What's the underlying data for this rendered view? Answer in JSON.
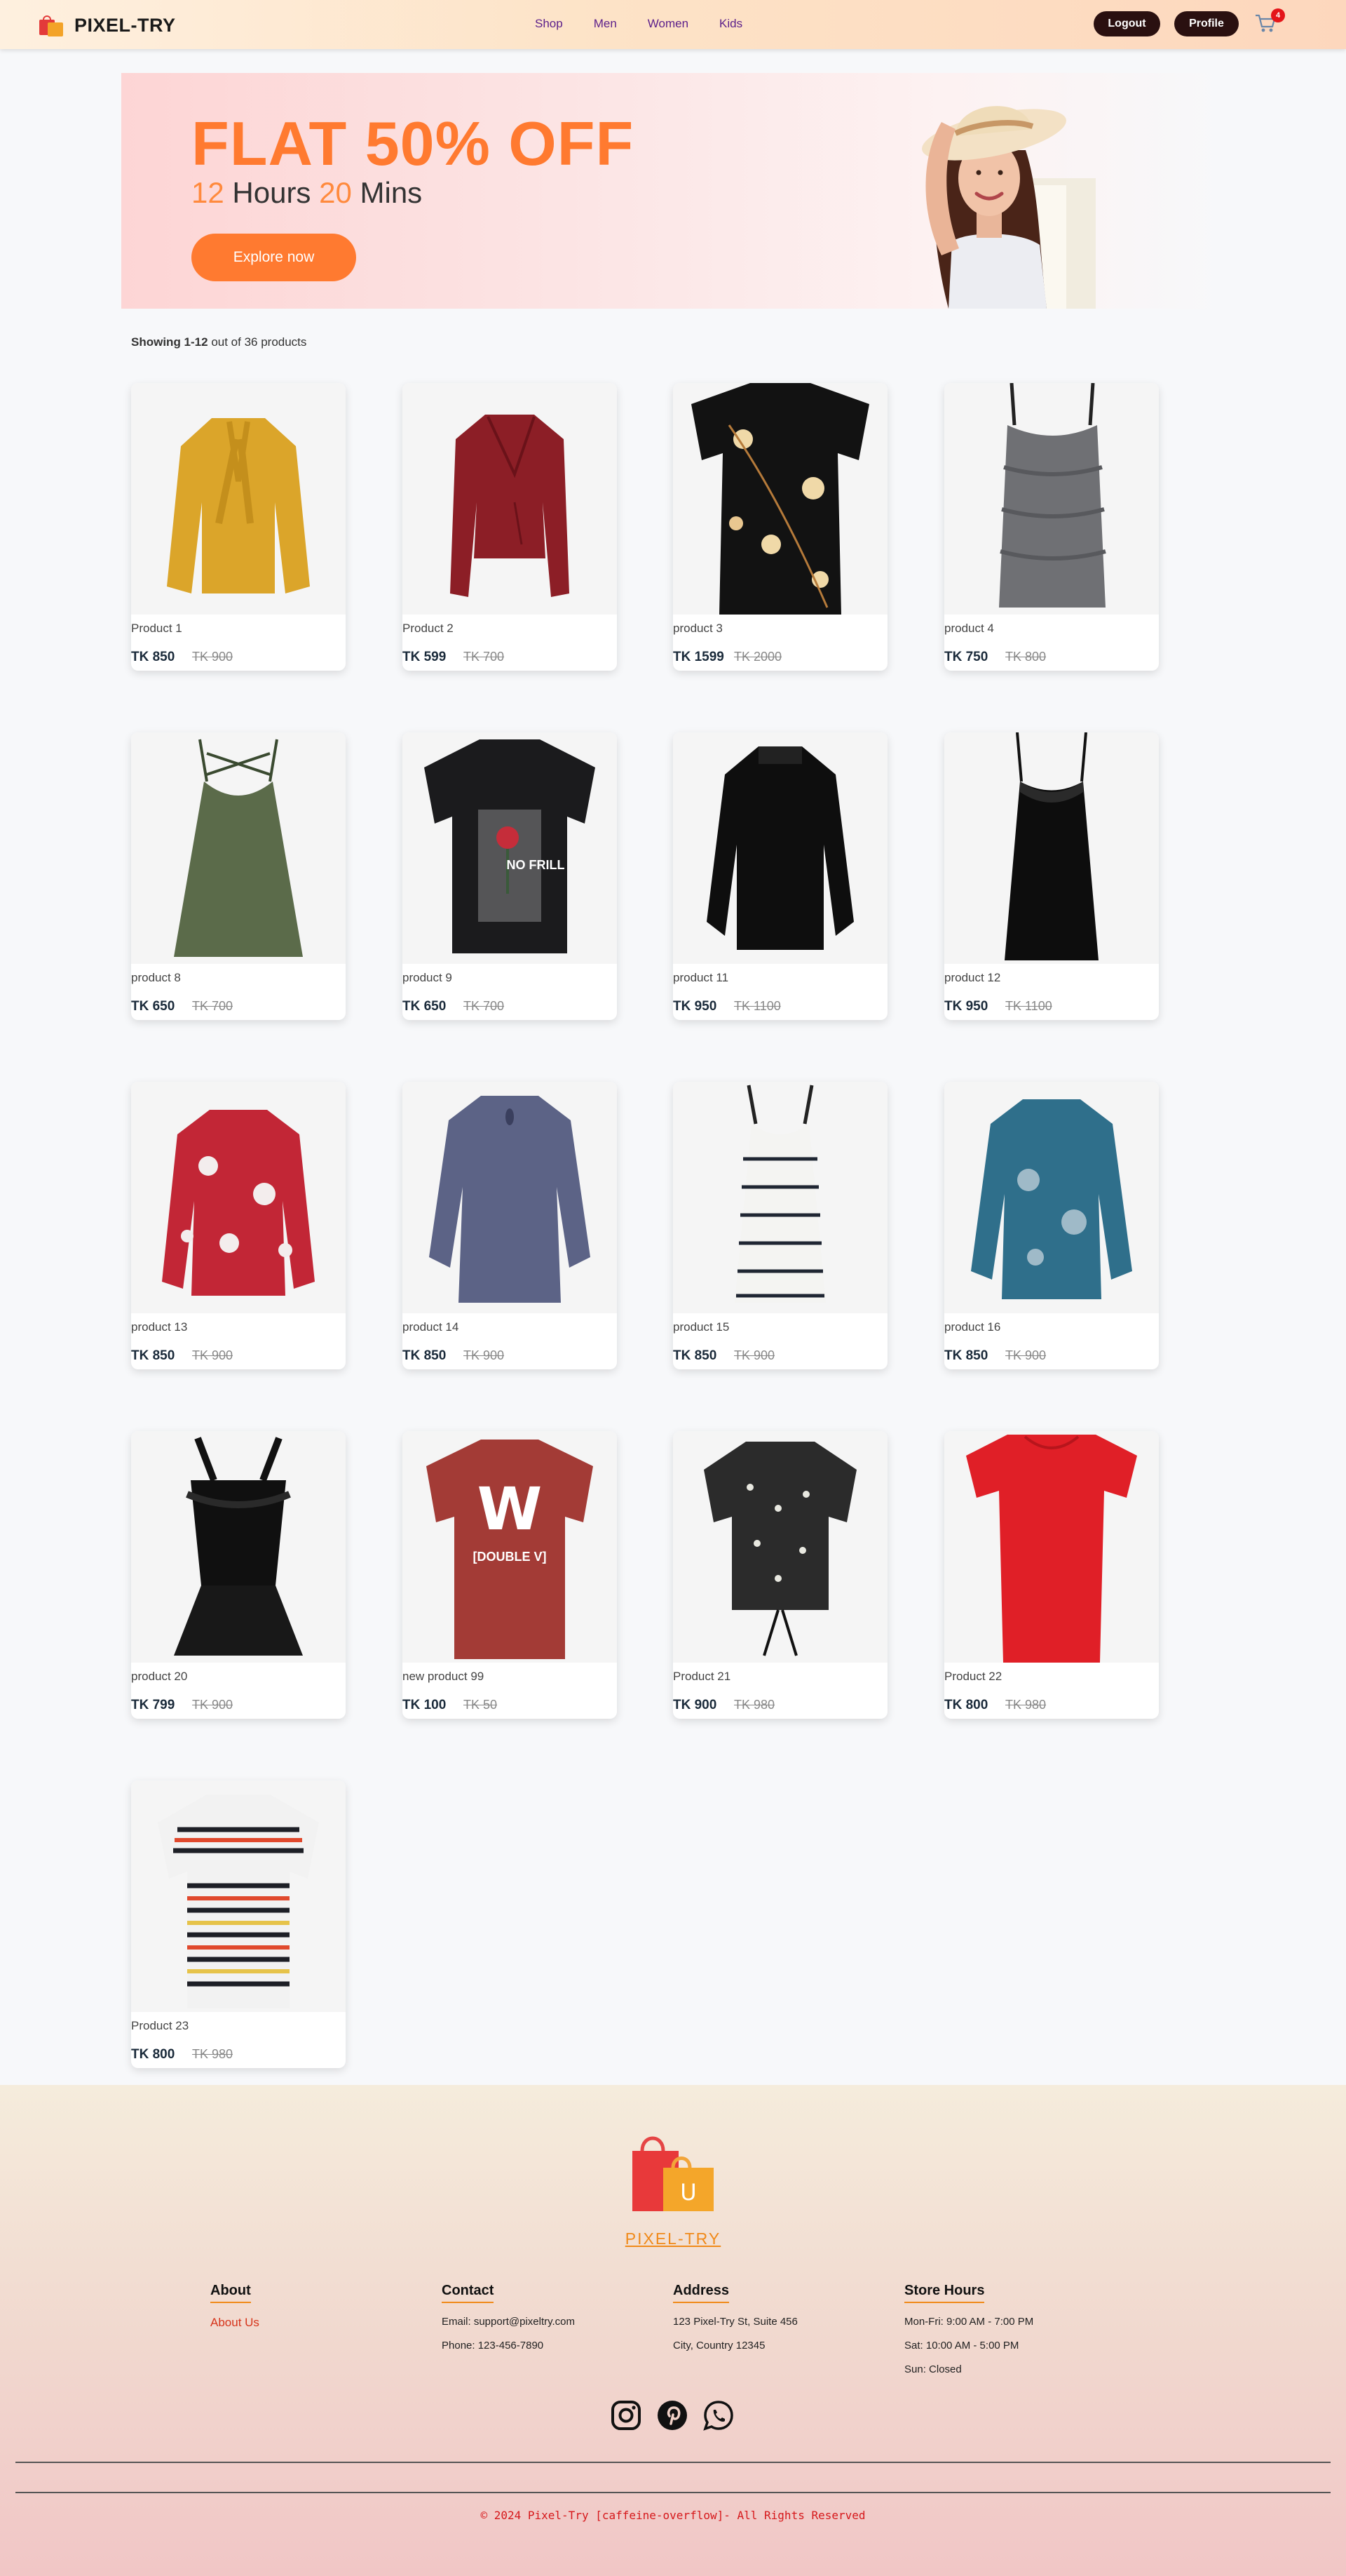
{
  "navbar": {
    "brand": "PIXEL-TRY",
    "links": [
      "Shop",
      "Men",
      "Women",
      "Kids"
    ],
    "logout_label": "Logout",
    "profile_label": "Profile",
    "cart_count": "4"
  },
  "hero": {
    "title": "FLAT 50% OFF",
    "timer_hours": "12",
    "timer_hours_label": "Hours",
    "timer_mins": "20",
    "timer_mins_label": "Mins",
    "button_label": "Explore now"
  },
  "listing": {
    "showing_bold": "Showing 1-12",
    "showing_rest": "out of 36 products"
  },
  "products": [
    {
      "name": "Product 1",
      "price": "TK 850",
      "old_price": "TK 900",
      "image": "mustard-bow-blouse"
    },
    {
      "name": "Product 2",
      "price": "TK 599",
      "old_price": "TK 700",
      "image": "burgundy-wrap-blouse"
    },
    {
      "name": "product 3",
      "price": "TK 1599",
      "old_price": "TK 2000",
      "image": "black-floral-top"
    },
    {
      "name": "product 4",
      "price": "TK 750",
      "old_price": "TK 800",
      "image": "grey-ruched-camisole"
    },
    {
      "name": "product 8",
      "price": "TK 650",
      "old_price": "TK 700",
      "image": "olive-cami-top"
    },
    {
      "name": "product 9",
      "price": "TK 650",
      "old_price": "TK 700",
      "image": "black-graphic-tshirt"
    },
    {
      "name": "product 11",
      "price": "TK 950",
      "old_price": "TK 1100",
      "image": "black-sheer-blouse"
    },
    {
      "name": "product 12",
      "price": "TK 950",
      "old_price": "TK 1100",
      "image": "black-slip-dress"
    },
    {
      "name": "product 13",
      "price": "TK 850",
      "old_price": "TK 900",
      "image": "red-floral-blouse"
    },
    {
      "name": "product 14",
      "price": "TK 850",
      "old_price": "TK 900",
      "image": "navy-keyhole-blouse"
    },
    {
      "name": "product 15",
      "price": "TK 850",
      "old_price": "TK 900",
      "image": "striped-tank-top"
    },
    {
      "name": "product 16",
      "price": "TK 850",
      "old_price": "TK 900",
      "image": "teal-paisley-top"
    },
    {
      "name": "product 20",
      "price": "TK 799",
      "old_price": "TK 900",
      "image": "black-ruffle-top"
    },
    {
      "name": "new product 99",
      "price": "TK 100",
      "old_price": "TK 50",
      "image": "red-logo-tshirt"
    },
    {
      "name": "Product 21",
      "price": "TK 900",
      "old_price": "TK 980",
      "image": "polka-dot-sheer-top"
    },
    {
      "name": "Product 22",
      "price": "TK 800",
      "old_price": "TK 980",
      "image": "red-bodycon-dress"
    },
    {
      "name": "Product 23",
      "price": "TK 800",
      "old_price": "TK 980",
      "image": "multicolor-striped-tee"
    }
  ],
  "footer": {
    "brand": "PIXEL-TRY",
    "about": {
      "title": "About",
      "link": "About Us"
    },
    "contact": {
      "title": "Contact",
      "email": "Email: support@pixeltry.com",
      "phone": "Phone: 123-456-7890"
    },
    "address": {
      "title": "Address",
      "line1": "123 Pixel-Try St, Suite 456",
      "line2": "City, Country 12345"
    },
    "hours": {
      "title": "Store Hours",
      "line1": "Mon-Fri: 9:00 AM - 7:00 PM",
      "line2": "Sat: 10:00 AM - 5:00 PM",
      "line3": "Sun: Closed"
    },
    "socials": [
      "instagram-icon",
      "pinterest-icon",
      "whatsapp-icon"
    ],
    "copyright": "© 2024 Pixel-Try [caffeine-overflow]- All Rights Reserved"
  },
  "colors": {
    "accent": "#ff7a30",
    "nav_link": "#5b1e8a",
    "button_dark": "#2a1010",
    "badge": "#e4151a"
  }
}
